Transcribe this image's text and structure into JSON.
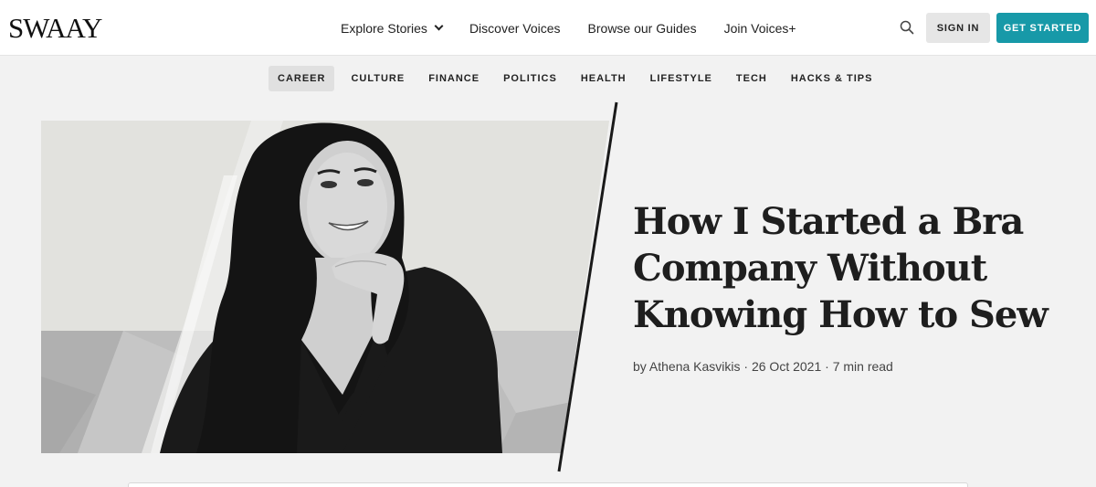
{
  "header": {
    "logo": "SWAAY",
    "nav": [
      {
        "label": "Explore Stories",
        "has_dropdown": true
      },
      {
        "label": "Discover Voices"
      },
      {
        "label": "Browse our Guides"
      },
      {
        "label": "Join Voices+"
      }
    ],
    "search_icon": "search-icon",
    "signin_label": "SIGN IN",
    "get_started_label": "GET STARTED"
  },
  "categories": [
    {
      "label": "CAREER",
      "active": true
    },
    {
      "label": "CULTURE"
    },
    {
      "label": "FINANCE"
    },
    {
      "label": "POLITICS"
    },
    {
      "label": "HEALTH"
    },
    {
      "label": "LIFESTYLE"
    },
    {
      "label": "TECH"
    },
    {
      "label": "HACKS & TIPS"
    }
  ],
  "article": {
    "title_lines": [
      "How I Started a Bra",
      "Company Without",
      "Knowing How to Sew"
    ],
    "author": "by Athena Kasvikis",
    "date": "26 Oct 2021",
    "read_time": "7 min read"
  },
  "colors": {
    "accent": "#1799a8",
    "page_bg": "#f2f2f2",
    "active_category_bg": "#e0e0e0"
  }
}
